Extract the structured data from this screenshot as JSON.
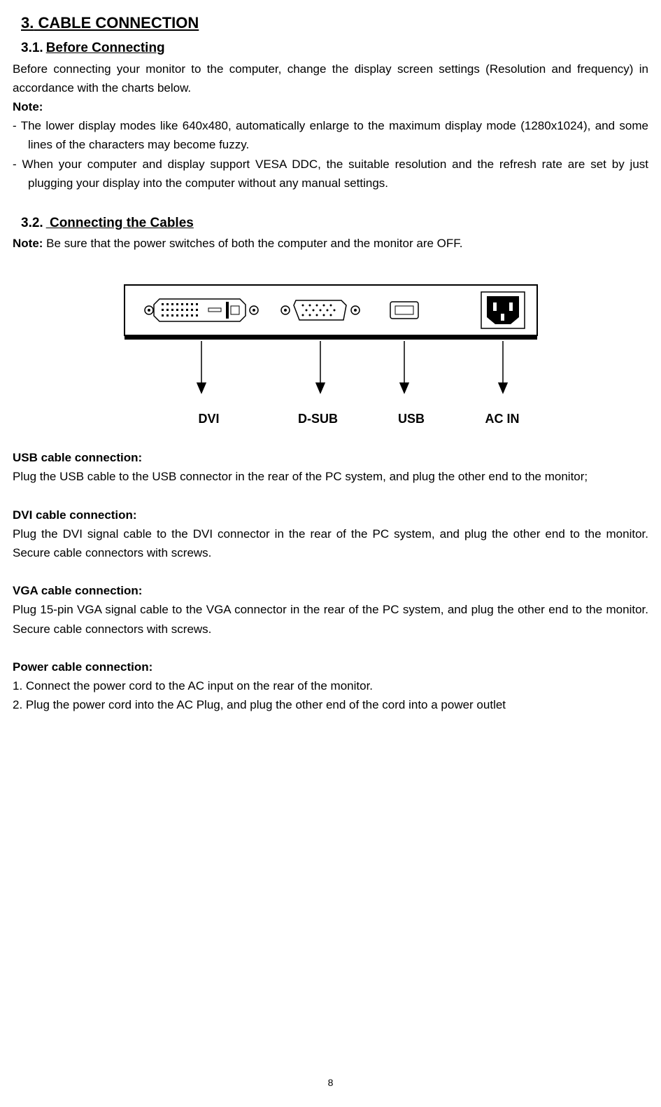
{
  "section": {
    "number": "3.",
    "title": "CABLE CONNECTION"
  },
  "sub1": {
    "number": "3.1.",
    "title": "Before Connecting",
    "intro": "Before connecting your monitor to the computer, change the display screen settings (Resolution and frequency) in accordance with the charts below.",
    "noteLabel": "Note:",
    "bullets": [
      "The lower display modes like 640x480, automatically enlarge to the maximum display mode (1280x1024), and some lines of the characters may become fuzzy.",
      "When your computer and display support VESA DDC, the suitable resolution and the refresh rate are set by just plugging your display into the computer without any manual settings."
    ]
  },
  "sub2": {
    "number": "3.2.",
    "title": " Connecting the Cables",
    "noteLabel": "Note:",
    "noteText": " Be sure that the power switches of both the computer and the monitor are OFF."
  },
  "ports": {
    "dvi": "DVI",
    "dsub": "D-SUB",
    "usb": "USB",
    "acin": "AC IN"
  },
  "usb": {
    "heading": "USB cable connection:",
    "text": "Plug the USB cable to the USB connector in the rear of the PC system, and plug the other end to the monitor;"
  },
  "dvi": {
    "heading": "DVI cable connection:",
    "text": "Plug the DVI signal cable to the DVI connector in the rear of the PC system, and plug the other end to the monitor.   Secure cable connectors with screws."
  },
  "vga": {
    "heading": "VGA cable connection:",
    "text": "Plug 15-pin VGA signal cable to the VGA connector in the rear of the PC system, and plug the other end to the monitor.   Secure cable connectors with screws."
  },
  "power": {
    "heading": "Power cable connection:",
    "step1": "1. Connect the power cord to the AC input on the rear of the monitor.",
    "step2": "2. Plug the power cord into the AC Plug, and plug the other end of the cord into a power outlet"
  },
  "pageNumber": "8"
}
